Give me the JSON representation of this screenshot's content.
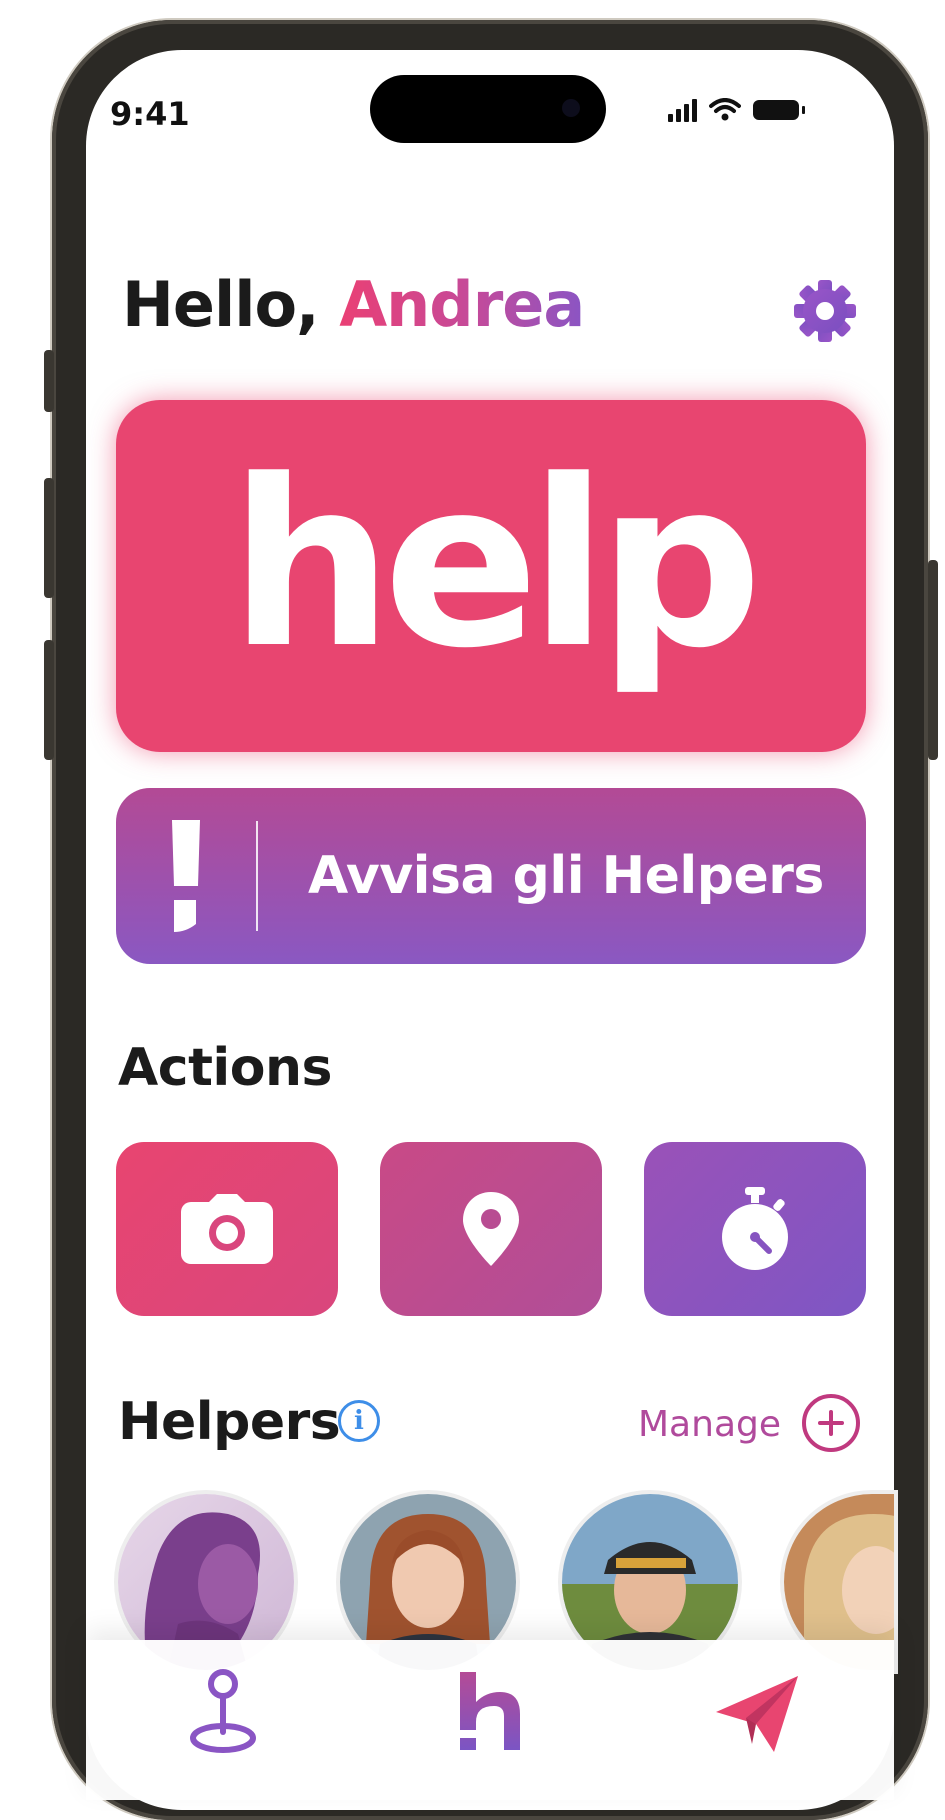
{
  "status_bar": {
    "time": "9:41"
  },
  "header": {
    "greeting_prefix": "Hello, ",
    "user_name": "Andrea"
  },
  "help_button": {
    "label": "help"
  },
  "alert_button": {
    "label": "Avvisa gli Helpers"
  },
  "actions": {
    "title": "Actions",
    "items": [
      {
        "icon": "camera-icon",
        "color": "#e84570"
      },
      {
        "icon": "location-pin-icon",
        "color": "#c14c8c"
      },
      {
        "icon": "stopwatch-icon",
        "color": "#8f55c0"
      }
    ]
  },
  "helpers": {
    "title": "Helpers",
    "info_icon": "info-icon",
    "manage_label": "Manage",
    "avatars": [
      "helper-1",
      "helper-2",
      "helper-3",
      "helper-4"
    ]
  },
  "tab_bar": {
    "items": [
      {
        "icon": "map-pin-icon"
      },
      {
        "icon": "h-logo-icon"
      },
      {
        "icon": "paper-plane-icon"
      }
    ]
  },
  "colors": {
    "brand_pink": "#e84570",
    "brand_purple": "#8a55c4",
    "info_blue": "#3e8ee8"
  }
}
